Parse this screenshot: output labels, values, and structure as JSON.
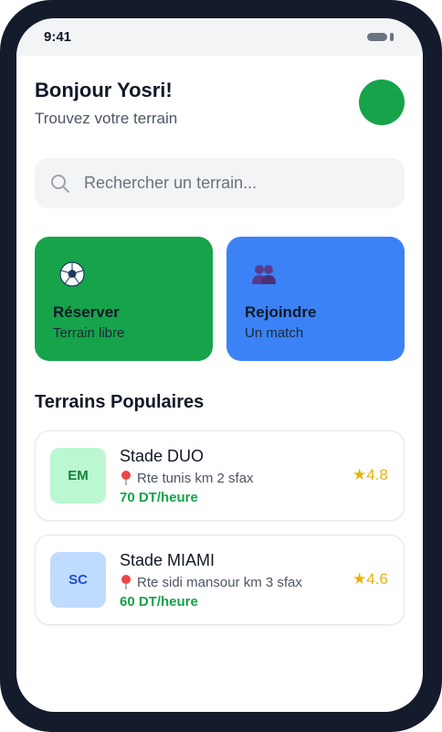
{
  "status": {
    "time": "9:41"
  },
  "header": {
    "greeting": "Bonjour Yosri!",
    "subtitle": "Trouvez votre terrain"
  },
  "search": {
    "placeholder": "Rechercher un terrain...",
    "icon": "search-icon"
  },
  "actions": [
    {
      "title": "Réserver",
      "subtitle": "Terrain libre",
      "icon": "soccer-ball-icon",
      "color": "#16a34a"
    },
    {
      "title": "Rejoindre",
      "subtitle": "Un match",
      "icon": "people-icon",
      "color": "#3b82f6"
    }
  ],
  "popular": {
    "title": "Terrains Populaires",
    "items": [
      {
        "initials": "EM",
        "name": "Stade DUO",
        "location": "Rte tunis km 2 sfax",
        "price": "70 DT/heure",
        "rating": "★4.8"
      },
      {
        "initials": "SC",
        "name": "Stade MIAMI",
        "location": "Rte sidi mansour km 3 sfax",
        "price": "60 DT/heure",
        "rating": "★4.6"
      }
    ]
  },
  "colors": {
    "accent_green": "#16a34a",
    "accent_blue": "#3b82f6",
    "frame": "#131b2c",
    "rating": "#eab308"
  }
}
